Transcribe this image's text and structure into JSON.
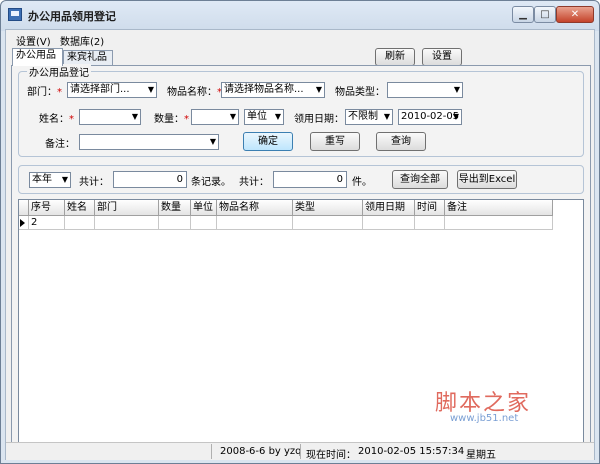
{
  "window": {
    "title": "办公用品领用登记",
    "min_glyph": "▁",
    "max_glyph": "□",
    "close_glyph": "✕"
  },
  "menu": [
    {
      "label": "设置(V)"
    },
    {
      "label": "数据库(2)"
    }
  ],
  "tabs": [
    {
      "label": "办公用品",
      "active": true
    },
    {
      "label": "来宾礼品",
      "active": false
    }
  ],
  "top_buttons": {
    "refresh": "刷新",
    "settings": "设置"
  },
  "form": {
    "group_title": "办公用品登记",
    "department": {
      "label": "部门：",
      "value": "请选择部门..."
    },
    "item_name": {
      "label": "物品名称：",
      "value": "请选择物品名称..."
    },
    "item_type": {
      "label": "物品类型：",
      "value": ""
    },
    "name": {
      "label": "姓名：",
      "value": ""
    },
    "quantity": {
      "label": "数量：",
      "value": ""
    },
    "unit": {
      "value": "单位"
    },
    "date": {
      "label": "领用日期：",
      "range": "不限制",
      "value": "2010-02-05"
    },
    "remark": {
      "label": "备注：",
      "value": ""
    },
    "required_mark": "*",
    "confirm": "确定",
    "rewrite": "重写",
    "query": "查询"
  },
  "filter": {
    "period": "本年",
    "total_label": "共计：",
    "records_count": "0",
    "records_suffix": "条记录。",
    "total_label2": "共计：",
    "pieces_count": "0",
    "pieces_suffix": "件。",
    "query_all": "查询全部",
    "export": "导出到Excel"
  },
  "grid": {
    "columns": [
      "序号",
      "姓名",
      "部门",
      "数量",
      "单位",
      "物品名称",
      "类型",
      "领用日期",
      "时间",
      "备注"
    ],
    "rows": [
      [
        "2",
        "",
        "",
        "",
        "",
        "",
        "",
        "",
        "",
        ""
      ]
    ]
  },
  "watermark": {
    "main": "脚本之家",
    "url": "www.jb51.net"
  },
  "status": {
    "author": "2008-6-6 by yzq",
    "time_label": "现在时间：",
    "datetime": "2010-02-05  15:57:34",
    "weekday": "星期五"
  },
  "arrow_glyph": "▼"
}
